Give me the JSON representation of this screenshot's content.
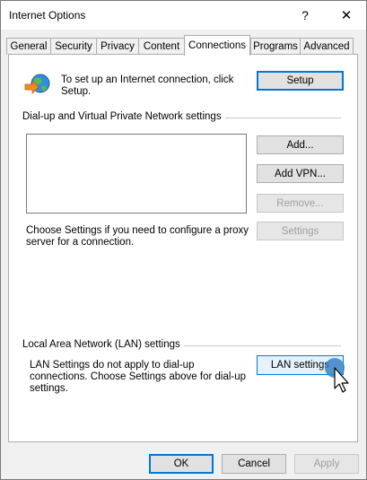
{
  "window": {
    "title": "Internet Options",
    "help_glyph": "?",
    "close_glyph": "✕"
  },
  "tabs": [
    {
      "label": "General",
      "active": false
    },
    {
      "label": "Security",
      "active": false
    },
    {
      "label": "Privacy",
      "active": false
    },
    {
      "label": "Content",
      "active": false
    },
    {
      "label": "Connections",
      "active": true
    },
    {
      "label": "Programs",
      "active": false
    },
    {
      "label": "Advanced",
      "active": false
    }
  ],
  "connections": {
    "setup_text": "To set up an Internet connection, click Setup.",
    "setup_button": "Setup",
    "dialup_heading": "Dial-up and Virtual Private Network settings",
    "connection_list": [],
    "add_button": "Add...",
    "add_vpn_button": "Add VPN...",
    "remove_button": "Remove...",
    "settings_button": "Settings",
    "proxy_text": "Choose Settings if you need to configure a proxy server for a connection.",
    "lan_heading": "Local Area Network (LAN) settings",
    "lan_text": "LAN Settings do not apply to dial-up connections. Choose Settings above for dial-up settings.",
    "lan_settings_button": "LAN settings"
  },
  "footer": {
    "ok_button": "OK",
    "cancel_button": "Cancel",
    "apply_button": "Apply"
  },
  "icons": {
    "globe": "globe-connection-icon",
    "cursor": "mouse-pointer-icon"
  },
  "colors": {
    "accent": "#0078d7",
    "cursor_highlight": "#3c82c8"
  }
}
